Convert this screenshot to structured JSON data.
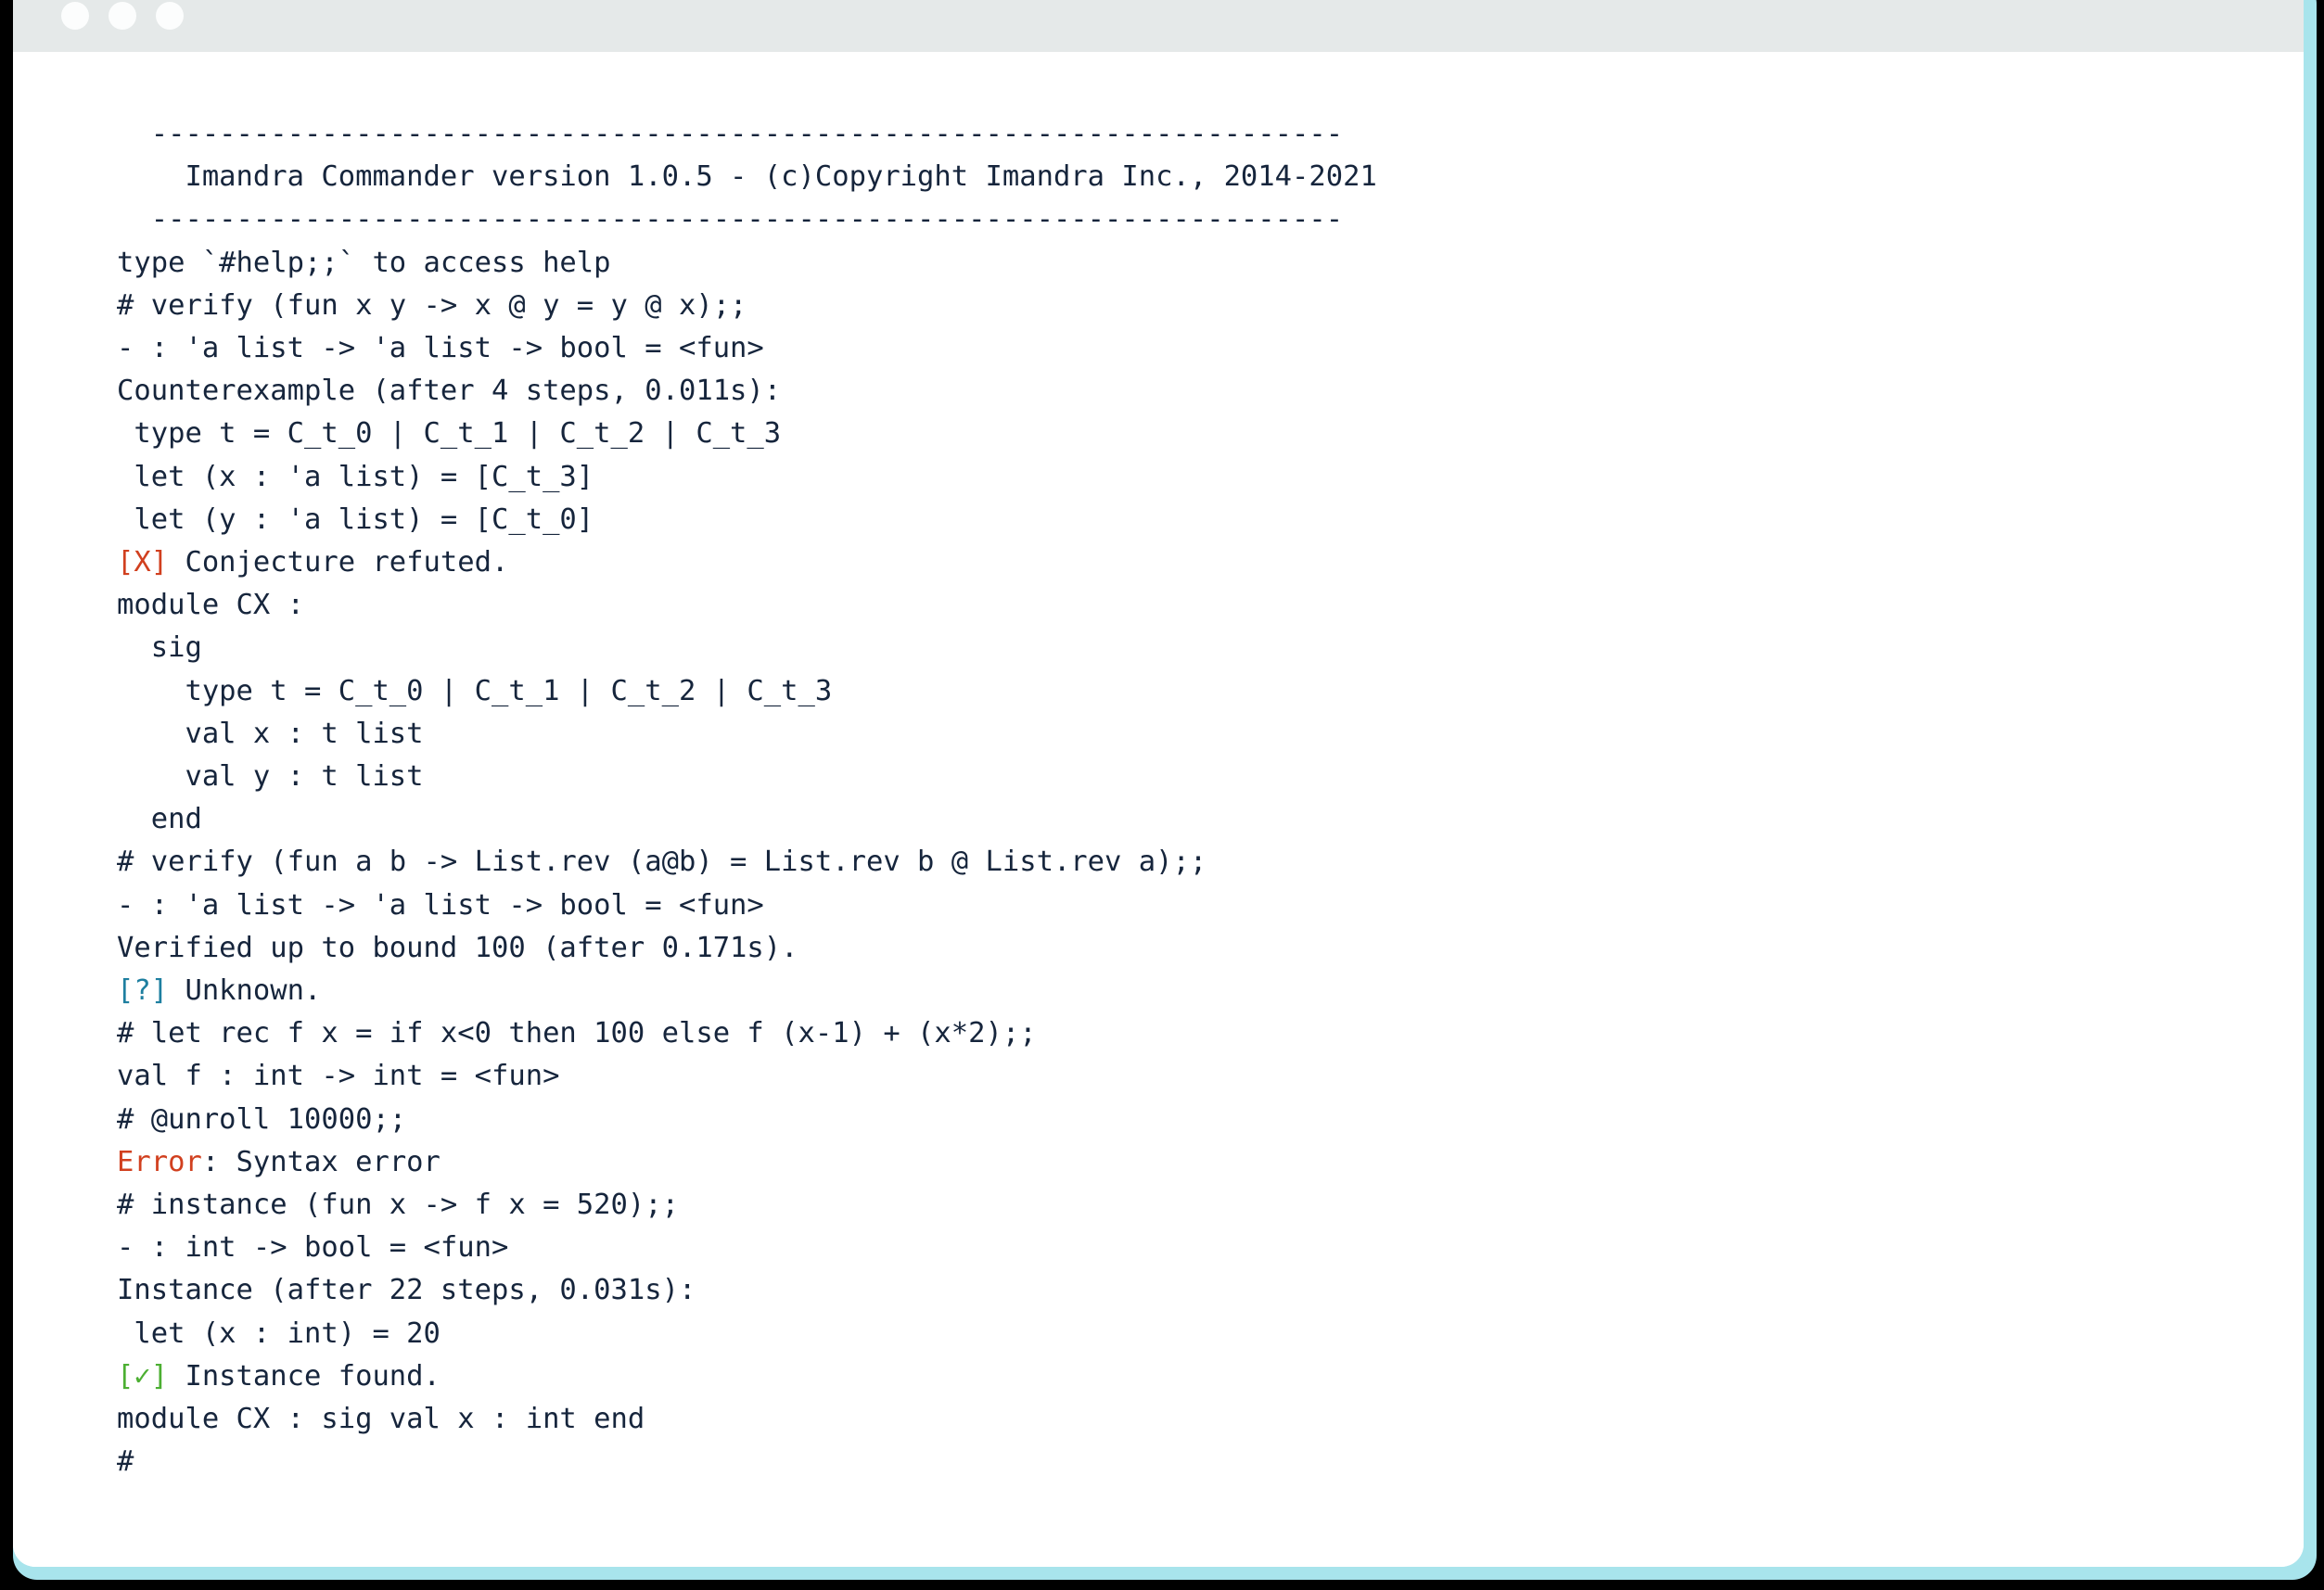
{
  "window": {
    "titlebar": {
      "dots": [
        "close-dot",
        "minimize-dot",
        "maximize-dot"
      ]
    },
    "accent_color": "#a8e4ec",
    "titlebar_color": "#e5e9e9",
    "background_color": "#ffffff",
    "page_background": "#000000"
  },
  "terminal": {
    "text_color": "#16253c",
    "error_color": "#d1401f",
    "unknown_color": "#1e7fa0",
    "success_color": "#4caf32",
    "lines": [
      {
        "id": "rule-top",
        "text": "  ----------------------------------------------------------------------"
      },
      {
        "id": "banner",
        "text": "    Imandra Commander version 1.0.5 - (c)Copyright Imandra Inc., 2014-2021"
      },
      {
        "id": "rule-bottom",
        "text": "  ----------------------------------------------------------------------"
      },
      {
        "id": "help-hint",
        "text": "type `#help;;` to access help"
      },
      {
        "id": "cmd-verify-append",
        "text": "# verify (fun x y -> x @ y = y @ x);;"
      },
      {
        "id": "type-verify-append",
        "text": "- : 'a list -> 'a list -> bool = <fun>"
      },
      {
        "id": "counterexample-header",
        "text": "Counterexample (after 4 steps, 0.011s):"
      },
      {
        "id": "cx-type-t",
        "text": " type t = C_t_0 | C_t_1 | C_t_2 | C_t_3"
      },
      {
        "id": "cx-let-x",
        "text": " let (x : 'a list) = [C_t_3]"
      },
      {
        "id": "cx-let-y",
        "text": " let (y : 'a list) = [C_t_0]"
      },
      {
        "id": "status-refuted",
        "marker": "[X]",
        "marker_color": "error",
        "text": " Conjecture refuted."
      },
      {
        "id": "module-cx-open",
        "text": "module CX :"
      },
      {
        "id": "sig-open",
        "text": "  sig"
      },
      {
        "id": "sig-type-t",
        "text": "    type t = C_t_0 | C_t_1 | C_t_2 | C_t_3"
      },
      {
        "id": "sig-val-x",
        "text": "    val x : t list"
      },
      {
        "id": "sig-val-y",
        "text": "    val y : t list"
      },
      {
        "id": "sig-end",
        "text": "  end"
      },
      {
        "id": "cmd-verify-rev",
        "text": "# verify (fun a b -> List.rev (a@b) = List.rev b @ List.rev a);;"
      },
      {
        "id": "type-verify-rev",
        "text": "- : 'a list -> 'a list -> bool = <fun>"
      },
      {
        "id": "verified-bound",
        "text": "Verified up to bound 100 (after 0.171s)."
      },
      {
        "id": "status-unknown",
        "marker": "[?]",
        "marker_color": "unknown",
        "text": " Unknown."
      },
      {
        "id": "cmd-let-rec-f",
        "text": "# let rec f x = if x<0 then 100 else f (x-1) + (x*2);;"
      },
      {
        "id": "val-f-type",
        "text": "val f : int -> int = <fun>"
      },
      {
        "id": "cmd-unroll",
        "text": "# @unroll 10000;;"
      },
      {
        "id": "error-syntax",
        "error_word": "Error",
        "text": ": Syntax error"
      },
      {
        "id": "cmd-instance",
        "text": "# instance (fun x -> f x = 520);;"
      },
      {
        "id": "type-instance",
        "text": "- : int -> bool = <fun>"
      },
      {
        "id": "instance-header",
        "text": "Instance (after 22 steps, 0.031s):"
      },
      {
        "id": "instance-let-x",
        "text": " let (x : int) = 20"
      },
      {
        "id": "status-instance-found",
        "marker": "[✓]",
        "marker_color": "success",
        "text": " Instance found."
      },
      {
        "id": "module-cx-inline",
        "text": "module CX : sig val x : int end"
      },
      {
        "id": "prompt",
        "text": "#"
      }
    ]
  }
}
